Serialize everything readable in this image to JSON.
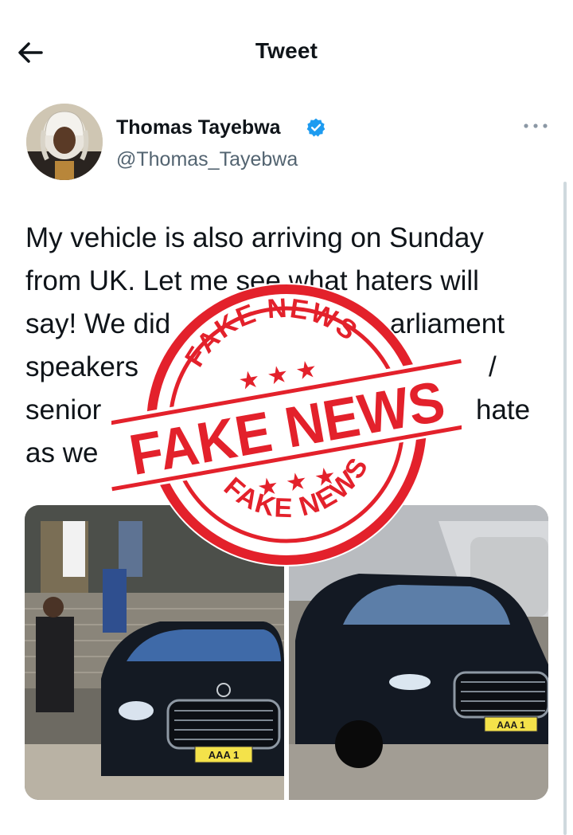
{
  "header": {
    "title": "Tweet",
    "back_icon": "arrow-left-icon"
  },
  "tweet": {
    "author_name": "Thomas Tayebwa",
    "author_handle": "@Thomas_Tayebwa",
    "verified_icon": "verified-badge-icon",
    "more_icon": "more-horizontal-icon",
    "text_lines": [
      "My vehicle is also arriving on Sunday",
      "from UK. Let me see what haters will",
      "say! We did",
      "arliament",
      "speakers",
      "/",
      "senior",
      "hate",
      "as we"
    ]
  },
  "media": {
    "left_plate": "AAA 1",
    "right_plate": "AAA 1"
  },
  "stamp": {
    "main_text": "FAKE NEWS",
    "top_arc_text": "FAKE NEWS",
    "bottom_arc_text": "FAKE NEWS",
    "color": "#e3212b"
  },
  "colors": {
    "text": "#0f1419",
    "muted": "#536471",
    "verified": "#1d9bf0"
  }
}
